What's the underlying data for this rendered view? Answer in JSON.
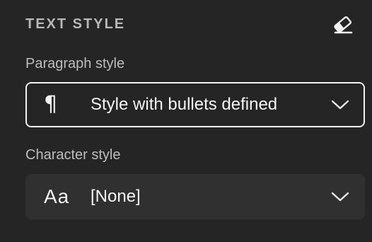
{
  "panel": {
    "title": "TEXT STYLE",
    "clear_icon": "eraser-icon"
  },
  "paragraph_style": {
    "label": "Paragraph style",
    "icon": "pilcrow-icon",
    "icon_glyph": "¶",
    "value": "Style with bullets defined",
    "focused": true
  },
  "character_style": {
    "label": "Character style",
    "icon": "character-style-icon",
    "icon_glyph": "Aa",
    "value": "[None]",
    "focused": false
  },
  "colors": {
    "background": "#252525",
    "field_background": "#303030",
    "focus_border": "#f2f2f2",
    "title_text": "#b8b8b8",
    "label_text": "#bdbdbd",
    "value_text": "#f5f5f5"
  }
}
